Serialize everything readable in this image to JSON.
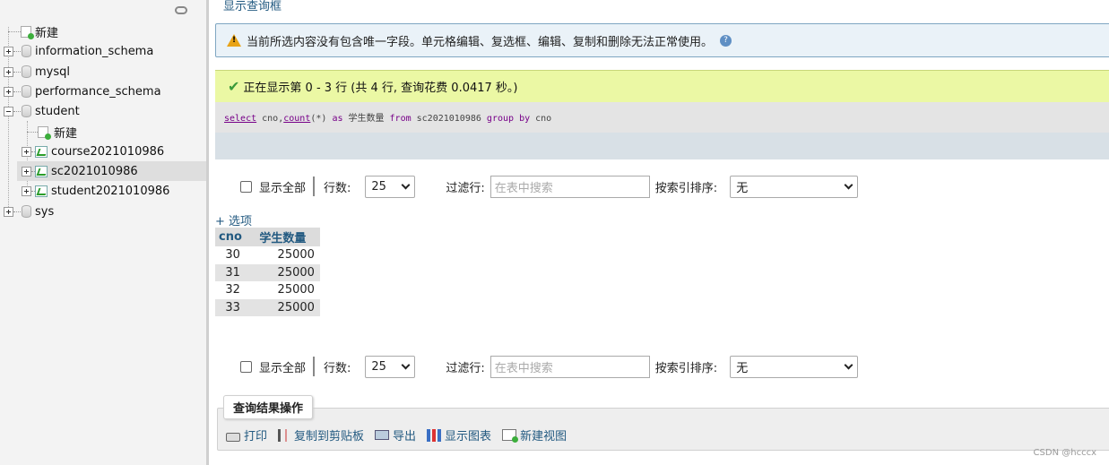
{
  "sidebar": {
    "new_label": "新建",
    "databases": [
      {
        "name": "information_schema"
      },
      {
        "name": "mysql"
      },
      {
        "name": "performance_schema"
      },
      {
        "name": "student"
      },
      {
        "name": "sys"
      }
    ],
    "student_children": [
      {
        "name": "新建"
      },
      {
        "name": "course2021010986"
      },
      {
        "name": "sc2021010986"
      },
      {
        "name": "student2021010986"
      }
    ]
  },
  "main": {
    "top_link": "显示查询框",
    "warning_text": "当前所选内容没有包含唯一字段。单元格编辑、复选框、编辑、复制和删除无法正常使用。",
    "success_text": "正在显示第 0 - 3 行 (共 4 行, 查询花费 0.0417 秒。)",
    "sql": {
      "select": "select",
      "cols": " cno,",
      "count": "count",
      "args": "(*) ",
      "as": "as",
      "alias": " 学生数量 ",
      "from": "from",
      "table": " sc2021010986 ",
      "group": "group",
      "by": "by",
      "groupcol": " cno"
    },
    "nav": {
      "show_all": "显示全部",
      "rows_label": "行数:",
      "rows_value": "25",
      "filter_label": "过滤行:",
      "filter_placeholder": "在表中搜索",
      "sort_label": "按索引排序:",
      "sort_value": "无"
    },
    "options_link": "+ 选项",
    "table": {
      "headers": [
        "cno",
        "学生数量"
      ],
      "rows": [
        [
          "30",
          "25000"
        ],
        [
          "31",
          "25000"
        ],
        [
          "32",
          "25000"
        ],
        [
          "33",
          "25000"
        ]
      ]
    },
    "ops": {
      "legend": "查询结果操作",
      "print": "打印",
      "copy": "复制到剪贴板",
      "export": "导出",
      "chart": "显示图表",
      "create_view": "新建视图"
    }
  },
  "watermark": "CSDN @hcccx"
}
